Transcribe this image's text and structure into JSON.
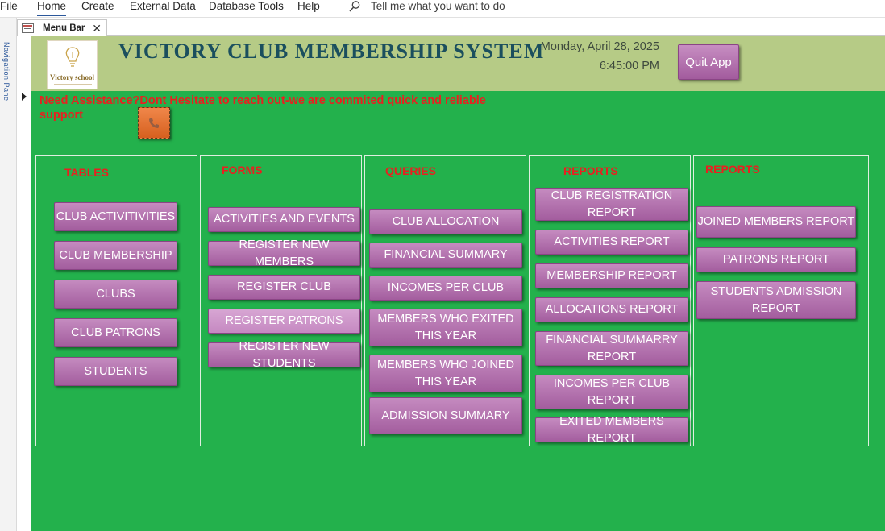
{
  "ribbon": {
    "file": "File",
    "home": "Home",
    "create": "Create",
    "external_data": "External Data",
    "database_tools": "Database Tools",
    "help": "Help",
    "tell_me": "Tell me what you want to do"
  },
  "nav_pane": {
    "label": "Navigation Pane"
  },
  "doc_tab": {
    "label": "Menu Bar",
    "close": "✕"
  },
  "header": {
    "logo_text": "Victory school",
    "title": "VICTORY CLUB MEMBERSHIP SYSTEM",
    "date": "Monday, April 28, 2025",
    "time": "6:45:00 PM",
    "quit_label": "Quit App"
  },
  "assist": {
    "text": "Need Assistance?Dont Hesitate to reach out-we are commited quick and reliable support"
  },
  "panels": {
    "tables": {
      "title": "TABLES",
      "buttons": [
        "CLUB ACTIVITIVITIES",
        "CLUB MEMBERSHIP",
        "CLUBS",
        "CLUB PATRONS",
        "STUDENTS"
      ]
    },
    "forms": {
      "title": "FORMS",
      "buttons": [
        "ACTIVITIES AND EVENTS",
        "REGISTER NEW MEMBERS",
        "REGISTER CLUB",
        "REGISTER PATRONS",
        "REGISTER NEW STUDENTS"
      ]
    },
    "queries": {
      "title": "QUERIES",
      "buttons": [
        "CLUB ALLOCATION",
        "FINANCIAL SUMMARY",
        "INCOMES PER CLUB",
        "MEMBERS WHO EXITED THIS YEAR",
        "MEMBERS WHO JOINED THIS YEAR",
        "ADMISSION SUMMARY"
      ]
    },
    "reports1": {
      "title": "REPORTS",
      "buttons": [
        "CLUB REGISTRATION REPORT",
        "ACTIVITIES REPORT",
        "MEMBERSHIP REPORT",
        "ALLOCATIONS REPORT",
        "FINANCIAL SUMMARRY REPORT",
        "INCOMES PER CLUB REPORT",
        "EXITED MEMBERS REPORT"
      ]
    },
    "reports2": {
      "title": "REPORTS",
      "buttons": [
        "JOINED MEMBERS REPORT",
        "PATRONS REPORT",
        "STUDENTS ADMISSION REPORT"
      ]
    }
  },
  "colors": {
    "header_bg": "#b6cb86",
    "detail_bg": "#23b14c",
    "button": "#b672b1",
    "title_red": "#e82020",
    "title_teal": "#1b4f5e"
  }
}
